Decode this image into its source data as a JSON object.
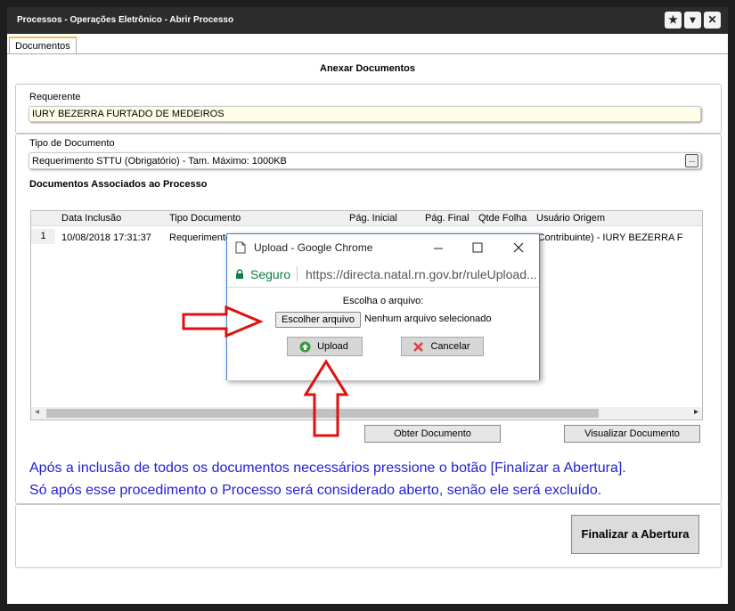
{
  "window": {
    "title": "Processos - Operações Eletrônico - Abrir Processo",
    "buttons": [
      "★",
      "▾",
      "✕"
    ]
  },
  "tabs": [
    "Documentos"
  ],
  "heading": "Anexar Documentos",
  "requerente": {
    "label": "Requerente",
    "value": "IURY BEZERRA FURTADO DE MEDEIROS"
  },
  "tipo_documento": {
    "label": "Tipo de Documento",
    "value": "Requerimento STTU (Obrigatório) - Tam. Máximo: 1000KB",
    "button": "..."
  },
  "docs_section": {
    "label": "Documentos Associados ao Processo",
    "columns": [
      "Data Inclusão",
      "Tipo Documento",
      "Pág. Inicial",
      "Pág. Final",
      "Qtde Folha",
      "Usuário Origem"
    ],
    "rows": [
      {
        "num": "1",
        "data": "10/08/2018 17:31:37",
        "tipo": "Requerimento Petição Notificação",
        "usuario": "(Contribuinte) - IURY BEZERRA F"
      }
    ],
    "scroll_left": "◂",
    "scroll_right": "▸"
  },
  "buttons": {
    "obter": "Obter Documento",
    "visualizar": "Visualizar Documento",
    "finalizar": "Finalizar a Abertura"
  },
  "info": {
    "line1": "Após a inclusão de todos os documentos necessários pressione o botão [Finalizar a Abertura].",
    "line2": "Só após esse procedimento o Processo será considerado aberto, senão ele será excluído."
  },
  "dialog": {
    "title": "Upload - Google Chrome",
    "secure": "Seguro",
    "url": "https://directa.natal.rn.gov.br/ruleUpload...",
    "choose_label": "Escolha o arquivo:",
    "file_button": "Escolher arquivo",
    "file_status": "Nenhum arquivo selecionado",
    "upload": "Upload",
    "cancel": "Cancelar"
  },
  "colors": {
    "info_text": "#1f1fd6",
    "arrow": "#e01010",
    "secure": "#0b8043"
  }
}
